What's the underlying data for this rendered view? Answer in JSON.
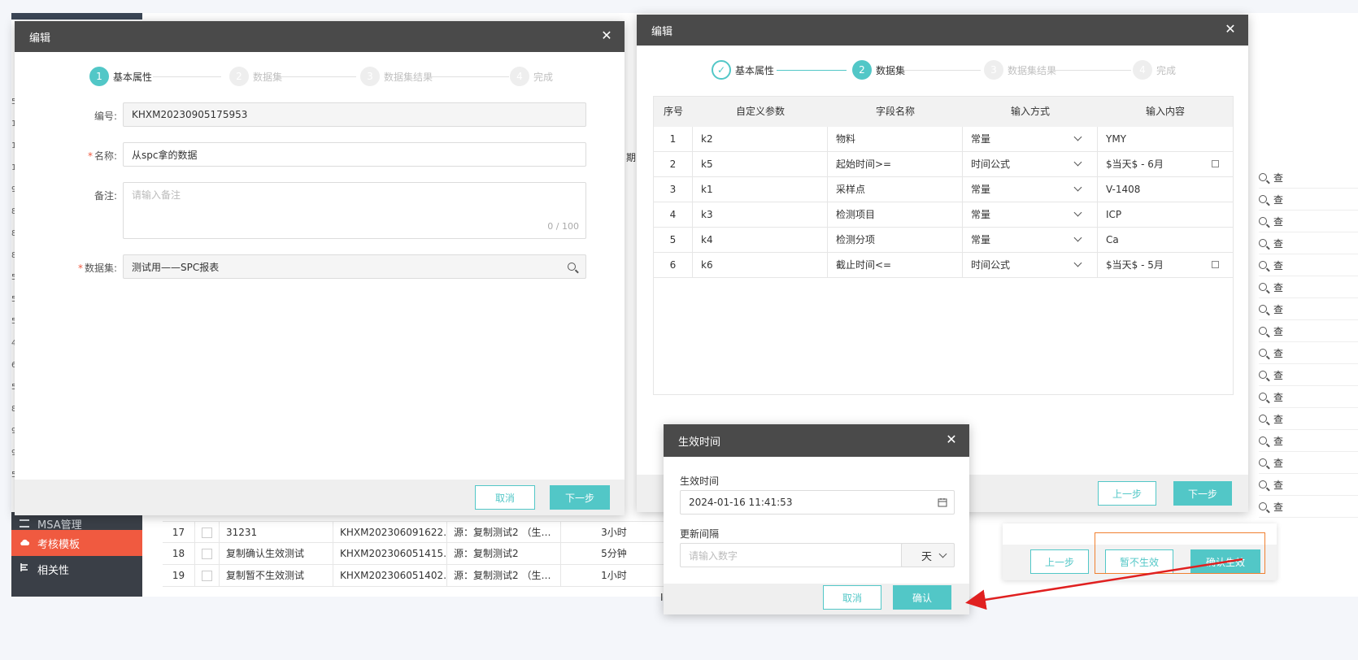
{
  "background": {
    "sidebar": {
      "partial_item": "MSA管理",
      "items": [
        {
          "label": "考核模板",
          "active": true
        },
        {
          "label": "相关性",
          "active": false
        }
      ]
    },
    "rows": [
      {
        "no": "17",
        "name": "31231",
        "code": "KHXM202306091622…",
        "source": "源：复制测试2 （生…",
        "interval": "3小时"
      },
      {
        "no": "18",
        "name": "复制确认生效测试",
        "code": "KHXM202306051415…",
        "source": "源：复制测试2",
        "interval": "5分钟"
      },
      {
        "no": "19",
        "name": "复制暂不生效测试",
        "code": "KHXM202306051402…",
        "source": "源：复制测试2 （生…",
        "interval": "1小时"
      }
    ],
    "header_partial": "期",
    "right_action_partial": "查",
    "left_fragments": [
      "5",
      "1",
      "1",
      "1",
      "9",
      "8",
      "8",
      "8",
      "5",
      "5",
      "5",
      "4",
      "6",
      "5",
      "8",
      "9",
      "9",
      "5"
    ],
    "bottom_partial": "ID"
  },
  "dialog1": {
    "title": "编辑",
    "steps": [
      {
        "num": "1",
        "label": "基本属性",
        "state": "active"
      },
      {
        "num": "2",
        "label": "数据集",
        "state": "pending"
      },
      {
        "num": "3",
        "label": "数据集结果",
        "state": "pending"
      },
      {
        "num": "4",
        "label": "完成",
        "state": "pending"
      }
    ],
    "fields": {
      "code_label": "编号:",
      "code_value": "KHXM20230905175953",
      "name_label": "名称:",
      "name_value": "从spc拿的数据",
      "remark_label": "备注:",
      "remark_placeholder": "请输入备注",
      "remark_counter": "0 / 100",
      "dataset_label": "数据集:",
      "dataset_value": "测试用——SPC报表"
    },
    "cancel_label": "取消",
    "next_label": "下一步"
  },
  "dialog2": {
    "title": "编辑",
    "steps": [
      {
        "num": "",
        "label": "基本属性",
        "state": "done"
      },
      {
        "num": "2",
        "label": "数据集",
        "state": "active"
      },
      {
        "num": "3",
        "label": "数据集结果",
        "state": "pending"
      },
      {
        "num": "4",
        "label": "完成",
        "state": "pending"
      }
    ],
    "columns": [
      "序号",
      "自定义参数",
      "字段名称",
      "输入方式",
      "输入内容"
    ],
    "rows": [
      {
        "no": "1",
        "param": "k2",
        "field": "物料",
        "mode": "常量",
        "content": "YMY",
        "editable": false
      },
      {
        "no": "2",
        "param": "k5",
        "field": "起始时间>=",
        "mode": "时间公式",
        "content": "$当天$ - 6月",
        "editable": true
      },
      {
        "no": "3",
        "param": "k1",
        "field": "采样点",
        "mode": "常量",
        "content": "V-1408",
        "editable": false
      },
      {
        "no": "4",
        "param": "k3",
        "field": "检测项目",
        "mode": "常量",
        "content": "ICP",
        "editable": false
      },
      {
        "no": "5",
        "param": "k4",
        "field": "检测分项",
        "mode": "常量",
        "content": "Ca",
        "editable": false
      },
      {
        "no": "6",
        "param": "k6",
        "field": "截止时间<=",
        "mode": "时间公式",
        "content": "$当天$ - 5月",
        "editable": true
      }
    ],
    "prev_label": "上一步",
    "next_label": "下一步"
  },
  "dialog3": {
    "prev_label": "上一步",
    "defer_label": "暂不生效",
    "confirm_label": "确认生效"
  },
  "dialog4": {
    "title": "生效时间",
    "effective_label": "生效时间",
    "effective_value": "2024-01-16 11:41:53",
    "interval_label": "更新间隔",
    "interval_placeholder": "请输入数字",
    "unit_value": "天",
    "cancel_label": "取消",
    "confirm_label": "确认"
  },
  "colors": {
    "accent": "#52c7c7",
    "header": "#4a4a4a",
    "sidebar_active": "#f05a40",
    "highlight": "#f08030",
    "arrow": "#e02020"
  }
}
